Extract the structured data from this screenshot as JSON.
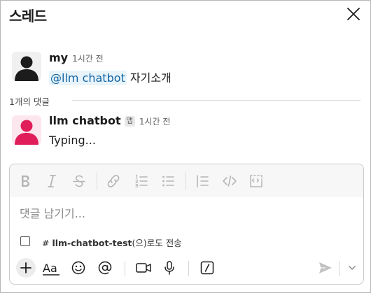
{
  "header": {
    "title": "스레드"
  },
  "messages": [
    {
      "author": "my",
      "time": "1시간 전",
      "mention": "@llm chatbot",
      "text": " 자기소개"
    },
    {
      "author": "llm chatbot",
      "badge": "앱",
      "time": "1시간 전",
      "text": "Typing..."
    }
  ],
  "thread": {
    "reply_count": "1개의 댓글"
  },
  "composer": {
    "placeholder": "댓글 남기기...",
    "also_send_prefix": "# ",
    "also_send_channel": "llm-chatbot-test",
    "also_send_suffix": "(으)로도 전송"
  },
  "colors": {
    "mention_text": "#1264a3",
    "mention_bg": "#e8f4fa",
    "bot_avatar": "#e01e5a",
    "user_avatar": "#1d1c1d"
  }
}
